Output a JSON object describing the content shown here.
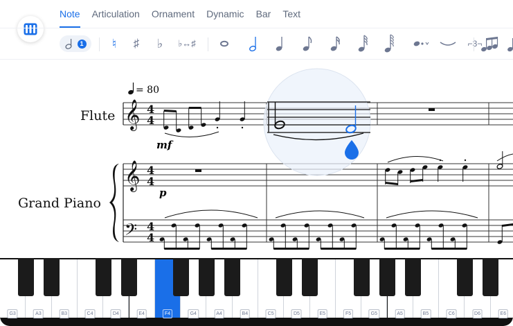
{
  "tabs": [
    {
      "label": "Note",
      "active": true
    },
    {
      "label": "Articulation",
      "active": false
    },
    {
      "label": "Ornament",
      "active": false
    },
    {
      "label": "Dynamic",
      "active": false
    },
    {
      "label": "Bar",
      "active": false
    },
    {
      "label": "Text",
      "active": false
    }
  ],
  "toolbar": {
    "voice_number": "1",
    "natural": "♮",
    "sharp": "♯",
    "flat": "♭",
    "enharmonic": "♭↔♯",
    "tuplet": "⌐3¬"
  },
  "score": {
    "tempo_value": "= 80",
    "instruments": [
      "Flute",
      "Grand Piano"
    ],
    "dynamics": [
      "mf",
      "p"
    ]
  },
  "keyboard": {
    "white_keys": [
      {
        "label": "G3",
        "active": false
      },
      {
        "label": "A3",
        "active": false
      },
      {
        "label": "B3",
        "active": false
      },
      {
        "label": "C4",
        "active": false
      },
      {
        "label": "D4",
        "active": false
      },
      {
        "label": "E4",
        "active": false
      },
      {
        "label": "F4",
        "active": true
      },
      {
        "label": "G4",
        "active": false
      },
      {
        "label": "A4",
        "active": false
      },
      {
        "label": "B4",
        "active": false
      },
      {
        "label": "C5",
        "active": false
      },
      {
        "label": "D5",
        "active": false
      },
      {
        "label": "E5",
        "active": false
      },
      {
        "label": "F5",
        "active": false
      },
      {
        "label": "G5",
        "active": false
      },
      {
        "label": "A5",
        "active": false
      },
      {
        "label": "B5",
        "active": false
      },
      {
        "label": "C6",
        "active": false
      },
      {
        "label": "D6",
        "active": false
      },
      {
        "label": "E6",
        "active": false
      }
    ],
    "accent_color": "#1a6fe8"
  }
}
